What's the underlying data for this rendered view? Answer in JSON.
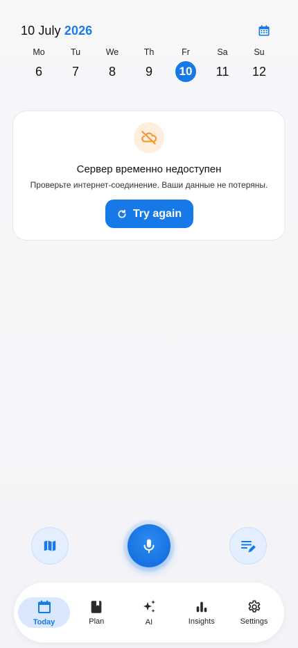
{
  "header": {
    "date_prefix": "10 July ",
    "year": "2026",
    "calendar_icon": "calendar-icon"
  },
  "week": {
    "days": [
      {
        "name": "Mo",
        "num": "6"
      },
      {
        "name": "Tu",
        "num": "7"
      },
      {
        "name": "We",
        "num": "8"
      },
      {
        "name": "Th",
        "num": "9"
      },
      {
        "name": "Fr",
        "num": "10"
      },
      {
        "name": "Sa",
        "num": "11"
      },
      {
        "name": "Su",
        "num": "12"
      }
    ],
    "selected_index": 4
  },
  "error": {
    "icon": "cloud-off-icon",
    "title": "Сервер временно недоступен",
    "subtitle": "Проверьте интернет-соединение. Ваши данные не потеряны.",
    "retry_label": "Try again"
  },
  "actions": {
    "left_icon": "map-icon",
    "center_icon": "microphone-icon",
    "right_icon": "edit-note-icon"
  },
  "nav": {
    "items": [
      {
        "label": "Today",
        "icon": "calendar-icon"
      },
      {
        "label": "Plan",
        "icon": "book-icon"
      },
      {
        "label": "AI",
        "icon": "sparkles-icon"
      },
      {
        "label": "Insights",
        "icon": "bar-chart-icon"
      },
      {
        "label": "Settings",
        "icon": "gear-icon"
      }
    ],
    "active_index": 0
  },
  "colors": {
    "accent": "#1778e8",
    "warning": "#f29a2e",
    "active_nav_bg": "#d9e8fd"
  }
}
